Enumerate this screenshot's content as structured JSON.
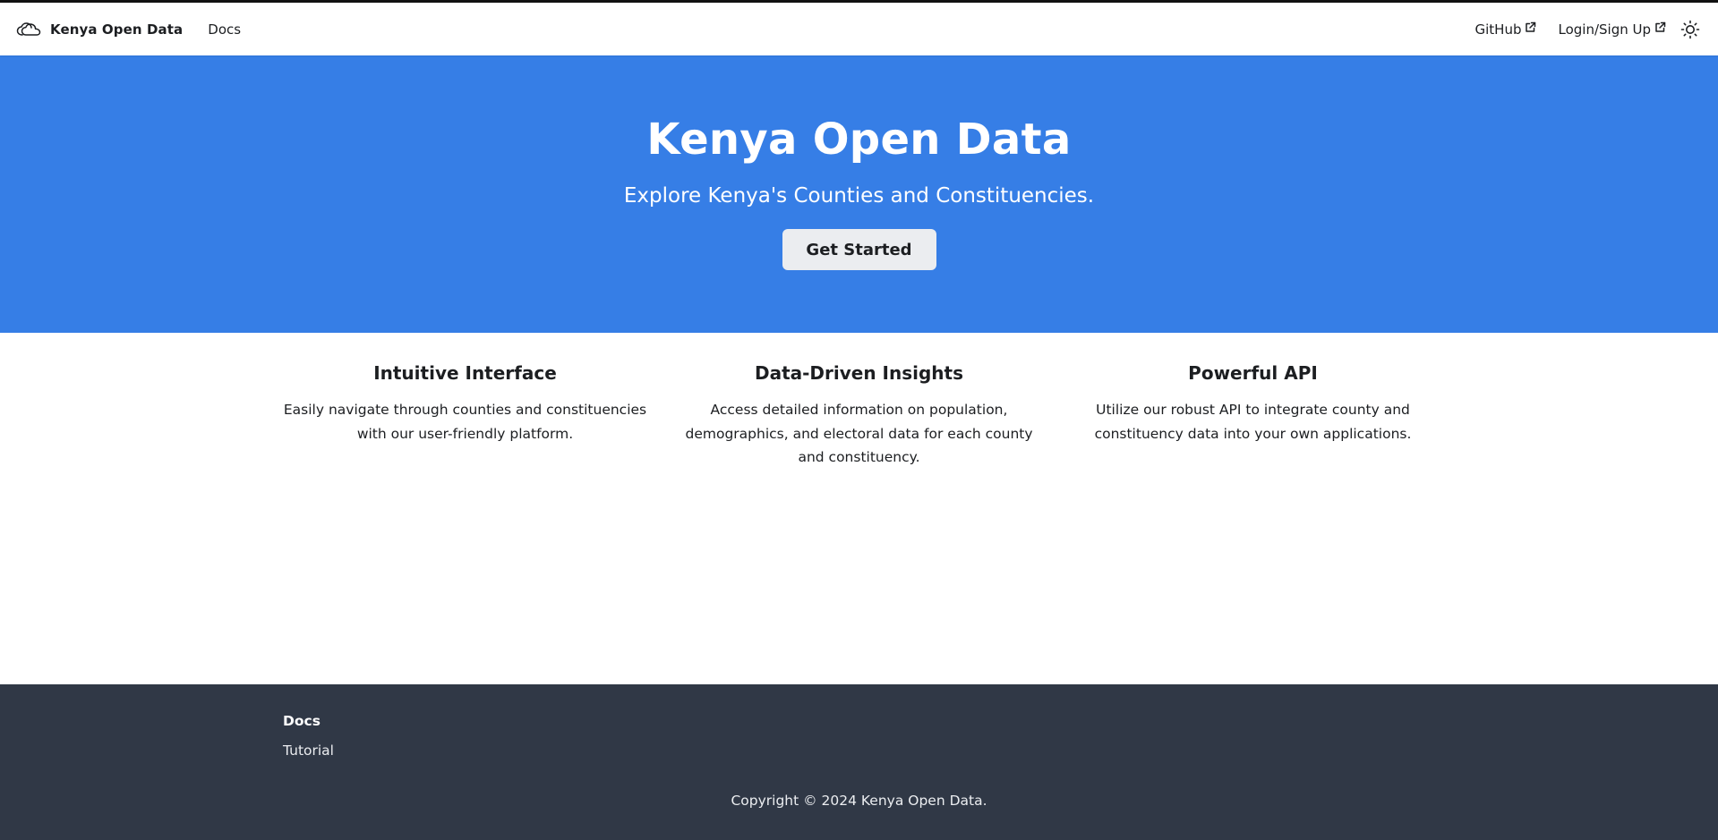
{
  "navbar": {
    "brand_title": "Kenya Open Data",
    "brand_icon": "cloud-logo-icon",
    "links_left": [
      {
        "label": "Docs"
      }
    ],
    "links_right": [
      {
        "label": "GitHub",
        "icon": "external-link-icon"
      },
      {
        "label": "Login/Sign Up",
        "icon": "external-link-icon"
      }
    ],
    "theme_toggle_icon": "sun-icon"
  },
  "hero": {
    "title": "Kenya Open Data",
    "subtitle": "Explore Kenya's Counties and Constituencies.",
    "button_label": "Get Started"
  },
  "features": [
    {
      "title": "Intuitive Interface",
      "text": "Easily navigate through counties and constituencies with our user-friendly platform."
    },
    {
      "title": "Data-Driven Insights",
      "text": "Access detailed information on population, demographics, and electoral data for each county and constituency."
    },
    {
      "title": "Powerful API",
      "text": "Utilize our robust API to integrate county and constituency data into your own applications."
    }
  ],
  "footer": {
    "heading": "Docs",
    "links": [
      {
        "label": "Tutorial"
      }
    ],
    "copyright": "Copyright © 2024 Kenya Open Data."
  },
  "colors": {
    "hero_background": "#367ee6",
    "footer_background": "#303846",
    "button_background": "#ebedf0"
  }
}
